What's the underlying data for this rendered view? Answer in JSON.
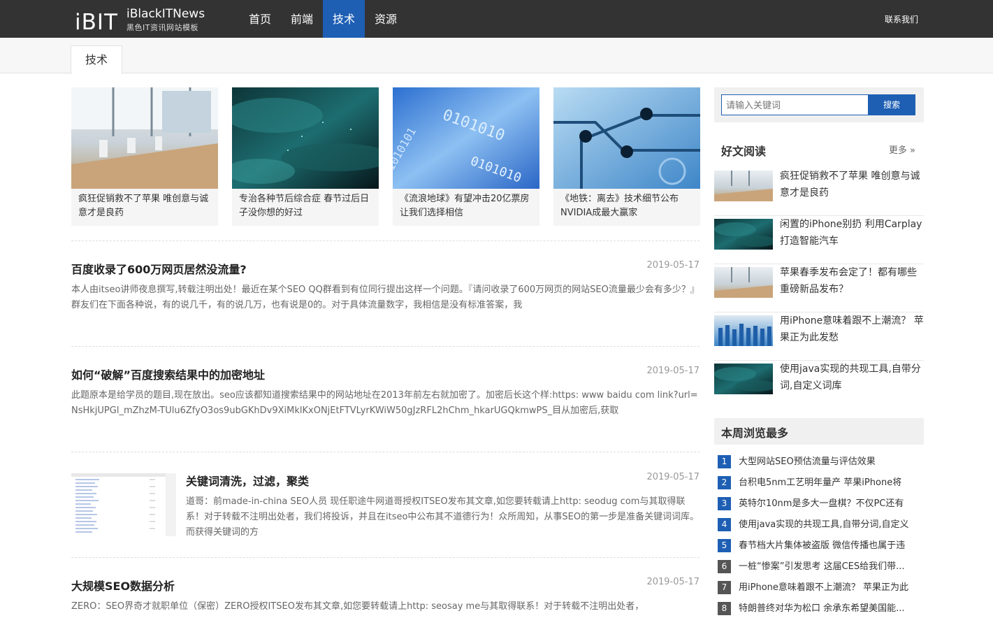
{
  "header": {
    "logo_mark": "iBIT",
    "logo_name": "iBlackITNews",
    "logo_sub": "黑色IT资讯网站模板",
    "nav": [
      {
        "label": "首页"
      },
      {
        "label": "前端"
      },
      {
        "label": "技术"
      },
      {
        "label": "资源"
      }
    ],
    "contact": "联系我们"
  },
  "subheader": {
    "tab": "技术"
  },
  "featured": [
    {
      "caption": "疯狂促销救不了苹果 唯创意与诚意才是良药",
      "image": "meeting-room-photo"
    },
    {
      "caption": "专治各种节后综合症 春节过后日子没你想的好过",
      "image": "teal-clouds-photo"
    },
    {
      "caption": "《流浪地球》有望冲击20亿票房 让我们选择相信",
      "image": "binary-blue-photo"
    },
    {
      "caption": "《地铁：离去》技术细节公布 NVIDIA成最大赢家",
      "image": "circuit-board-photo"
    }
  ],
  "articles": [
    {
      "title": "百度收录了600万网页居然没流量?",
      "date": "2019-05-17",
      "excerpt": "本人由itseo讲师夜息撰写,转载注明出处！最近在某个SEO QQ群看到有位同行提出这样一个问题。『请问收录了600万网页的网站SEO流量最少会有多少？』群友们在下面各种说，有的说几千，有的说几万，也有说是0的。对于具体流量数字，我相信是没有标准答案，我"
    },
    {
      "title": "如何“破解”百度搜索结果中的加密地址",
      "date": "2019-05-17",
      "excerpt": "此题原本是给学员的题目,现在放出。seo应该都知道搜索结果中的网站地址在2013年前左右就加密了。加密后长这个样:https: www baidu com link?url=NsHkjUPGl_mZhzM-TUlu6ZfyO3os9ubGKhDv9XiMklKxONjEtFTVLyrKWiW50gJzRFL2hChm_hkarUGQkmwPS_目从加密后,获取"
    },
    {
      "title": "关键词清洗，过滤，聚类",
      "date": "2019-05-17",
      "excerpt": "道哥：前made-in-china SEO人员 现任职途牛网道哥授权ITSEO发布其文章,如您要转载请上http: seodug com与其取得联系！对于转载不注明出处者，我们将投诉，并且在itseo中公布其不道德行为！众所周知，从事SEO的第一步是准备关键词词库。而获得关键词的方"
    },
    {
      "title": "大规模SEO数据分析",
      "date": "2019-05-17",
      "excerpt": "ZERO：SEO界奇才就职单位（保密）ZERO授权ITSEO发布其文章,如您要转载请上http: seosay me与其取得联系！对于转载不注明出处者，"
    }
  ],
  "sidebar": {
    "search": {
      "placeholder": "请输入关键词",
      "button": "搜索"
    },
    "good_reads": {
      "title": "好文阅读",
      "more": "更多 »",
      "items": [
        {
          "text": "疯狂促销救不了苹果 唯创意与诚意才是良药"
        },
        {
          "text": "闲置的iPhone别扔 利用Carplay打造智能汽车"
        },
        {
          "text": "苹果春季发布会定了！都有哪些重磅新品发布？"
        },
        {
          "text": "用iPhone意味着跟不上潮流？ 苹果正为此发愁"
        },
        {
          "text": "使用java实现的共现工具,自带分词,自定义词库"
        }
      ]
    },
    "weekly": {
      "title": "本周浏览最多",
      "items": [
        {
          "num": "1",
          "text": "大型网站SEO预估流量与评估效果"
        },
        {
          "num": "2",
          "text": "台积电5nm工艺明年量产 苹果iPhone将"
        },
        {
          "num": "3",
          "text": "英特尔10nm是多大一盘棋？不仅PC还有"
        },
        {
          "num": "4",
          "text": "使用java实现的共现工具,自带分词,自定义"
        },
        {
          "num": "5",
          "text": "春节档大片集体被盗版 微信传播也属于违"
        },
        {
          "num": "6",
          "text": "一桩“惨案”引发思考 这届CES给我们带..."
        },
        {
          "num": "7",
          "text": "用iPhone意味着跟不上潮流？ 苹果正为此"
        },
        {
          "num": "8",
          "text": "特朗普终对华为松口 余承东希望美国能..."
        }
      ]
    }
  }
}
